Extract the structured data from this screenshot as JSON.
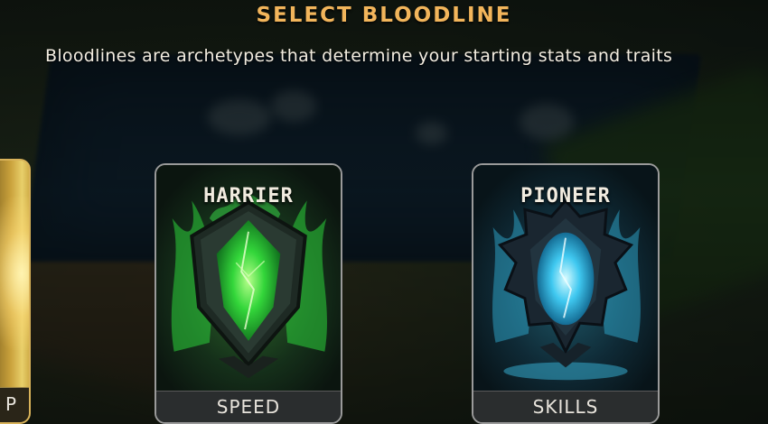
{
  "header": {
    "title": "SELECT BLOODLINE",
    "subtitle": "Bloodlines are archetypes that determine your starting stats and traits"
  },
  "cards": [
    {
      "name": "",
      "trait": "P",
      "accent": "#d9b35a"
    },
    {
      "name": "HARRIER",
      "trait": "SPEED",
      "accent": "#3fe04a"
    },
    {
      "name": "PIONEER",
      "trait": "SKILLS",
      "accent": "#3fc8f0"
    }
  ]
}
